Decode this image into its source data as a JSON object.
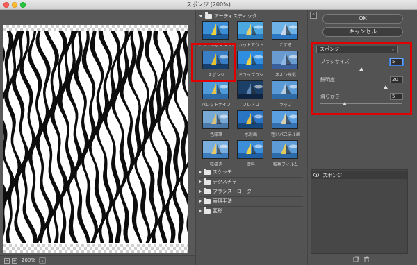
{
  "window": {
    "title": "スポンジ (200%)"
  },
  "preview": {
    "zoom": "200%",
    "zoom_out": "−",
    "zoom_in": "+",
    "zoom_menu": "⌄"
  },
  "gallery": {
    "expanded_category": "アーティスティック",
    "thumbnails": [
      {
        "label": "エッジのポスタリゼーション",
        "colors": [
          "#3b8fd6",
          "#f2d23a",
          "#1c5c9a"
        ]
      },
      {
        "label": "カットアウト",
        "colors": [
          "#4aa7e0",
          "#e9ce6a",
          "#2a7cc0"
        ]
      },
      {
        "label": "こする",
        "colors": [
          "#6fb3e6",
          "#c9d6ea",
          "#2d78c4"
        ]
      },
      {
        "label": "スポンジ",
        "colors": [
          "#3a7fc6",
          "#e8c22c",
          "#173f6e"
        ]
      },
      {
        "label": "ドライブラシ",
        "colors": [
          "#2f8ee0",
          "#f0d244",
          "#185fa8"
        ]
      },
      {
        "label": "ネオン光彩",
        "colors": [
          "#6a9bd0",
          "#8fb8e6",
          "#3a5f9a"
        ]
      },
      {
        "label": "パレットナイフ",
        "colors": [
          "#4f9ad8",
          "#e4c54a",
          "#2c6aa8"
        ]
      },
      {
        "label": "フレスコ",
        "colors": [
          "#1b3f66",
          "#5d86b5",
          "#0e2440"
        ]
      },
      {
        "label": "ラップ",
        "colors": [
          "#5a9ad6",
          "#b6cbe0",
          "#2e6aa6"
        ]
      },
      {
        "label": "色鉛筆",
        "colors": [
          "#78a8d4",
          "#d8c27a",
          "#4a78a8"
        ]
      },
      {
        "label": "水彩画",
        "colors": [
          "#2a74c4",
          "#e9c54a",
          "#15487e"
        ]
      },
      {
        "label": "粗いパステル画",
        "colors": [
          "#5aa0e0",
          "#d9d1b0",
          "#3470b0"
        ]
      },
      {
        "label": "粒描き",
        "colors": [
          "#7aaede",
          "#e6c96a",
          "#3d7cbc"
        ]
      },
      {
        "label": "塗料",
        "colors": [
          "#3d8ed8",
          "#f1d34b",
          "#1e60a6"
        ]
      },
      {
        "label": "粒状フィルム",
        "colors": [
          "#5c9bd6",
          "#e3ca5c",
          "#2c6aa8"
        ]
      }
    ],
    "categories": [
      "スケッチ",
      "テクスチャ",
      "ブラシストローク",
      "表現手法",
      "変形"
    ]
  },
  "actions": {
    "ok": "OK",
    "cancel": "キャンセル",
    "collapse": "⌃"
  },
  "settings": {
    "filter": "スポンジ",
    "params": [
      {
        "label": "ブラシサイズ",
        "value": "5",
        "fraction": 0.5
      },
      {
        "label": "鮮明度",
        "value": "20",
        "fraction": 0.8
      },
      {
        "label": "滑らかさ",
        "value": "5",
        "fraction": 0.3
      }
    ]
  },
  "layers": {
    "items": [
      {
        "label": "スポンジ"
      }
    ]
  }
}
